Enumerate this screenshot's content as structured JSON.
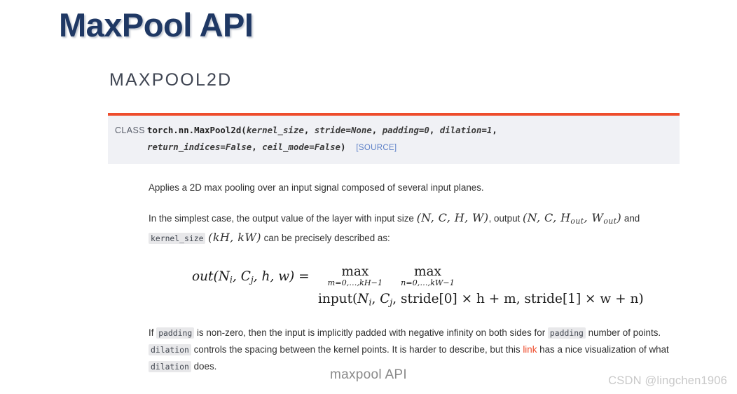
{
  "slide": {
    "title": "MaxPool API",
    "title_color": "#1f3864",
    "caption": "maxpool API",
    "watermark": "CSDN @lingchen1906"
  },
  "doc": {
    "heading": "MAXPOOL2D",
    "accent_color": "#ee4c2c",
    "signature": {
      "label": "CLASS",
      "qualified_name": "torch.nn.MaxPool2d",
      "open_paren": "(",
      "args_line1": [
        "kernel_size",
        "stride=None",
        "padding=0",
        "dilation=1"
      ],
      "args_line2": [
        "return_indices=False",
        "ceil_mode=False"
      ],
      "close_paren": ")",
      "source_link": "[SOURCE]"
    },
    "paragraphs": {
      "p1": "Applies a 2D max pooling over an input signal composed of several input planes.",
      "p2_a": "In the simplest case, the output value of the layer with input size",
      "p2_size_input": "(N, C, H, W)",
      "p2_b": ", output",
      "p2_size_output": "(N, C, H",
      "p2_c": "and",
      "p2_code": "kernel_size",
      "p2_kernel": "(kH, kW)",
      "p2_d": "can be precisely described as:",
      "p3_a": "If",
      "p3_code1": "padding",
      "p3_b": "is non-zero, then the input is implicitly padded with negative infinity on both sides for",
      "p3_code2": "padding",
      "p3_c": "number of points.",
      "p3_code3": "dilation",
      "p3_d": "controls the spacing between the kernel points. It is harder to describe, but this",
      "p3_link": "link",
      "p3_e": "has a nice visualization of what",
      "p3_code4": "dilation",
      "p3_f": "does."
    },
    "equation": {
      "lhs": "out(N",
      "lhs_i": "i",
      "lhs_mid": ", C",
      "lhs_j": "j",
      "lhs_end": ", h, w) =",
      "max1_op": "max",
      "max1_limit": "m=0,…,kH−1",
      "max2_op": "max",
      "max2_limit": "n=0,…,kW−1",
      "line2_fn": "input(",
      "line2_rest": ", stride[0] × h + m, stride[1] × w + n)"
    }
  }
}
